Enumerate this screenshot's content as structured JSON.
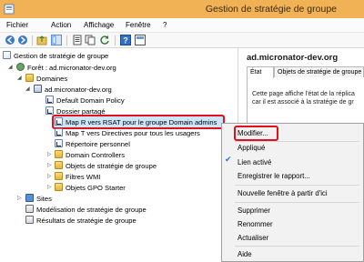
{
  "window": {
    "title": "Gestion de stratégie de groupe"
  },
  "menubar": {
    "items": [
      "Fichier",
      "Action",
      "Affichage",
      "Fenêtre",
      "?"
    ]
  },
  "toolbar": {
    "buttons": [
      "back-icon",
      "forward-icon",
      "up-folder-icon",
      "show-tree-icon",
      "properties-icon",
      "copy-icon",
      "refresh-icon",
      "help-icon",
      "console-icon"
    ]
  },
  "tree": {
    "root": "Gestion de stratégie de groupe",
    "forest": "Forêt : ad.micronator-dev.org",
    "domains": "Domaines",
    "domain": "ad.micronator-dev.org",
    "items": [
      "Default Domain Policy",
      "Dossier partagé",
      "Map R vers RSAT pour le groupe Domain admins",
      "Map T vers Directives pour tous les usagers",
      "Répertoire personnel",
      "Domain Controllers",
      "Objets de stratégie de groupe",
      "Filtres WMI",
      "Objets GPO Starter"
    ],
    "sites": "Sites",
    "modeling": "Modélisation de stratégie de groupe",
    "results": "Résultats de stratégie de groupe"
  },
  "right_pane": {
    "title": "ad.micronator-dev.org",
    "tabs": [
      "État",
      "Objets de stratégie de groupe"
    ],
    "text_line1": "Cette page affiche l'état de la réplica",
    "text_line2": "car il est associé à la stratégie de gr"
  },
  "context_menu": {
    "items": [
      "Modifier...",
      "Appliqué",
      "Lien activé",
      "Enregistrer le rapport...",
      "Nouvelle fenêtre à partir d'ici",
      "Supprimer",
      "Renommer",
      "Actualiser",
      "Aide"
    ],
    "checked_item": "Lien activé"
  },
  "colors": {
    "titlebar": "#f0b254",
    "highlight": "#e0101c",
    "selection": "#cde6f7"
  }
}
